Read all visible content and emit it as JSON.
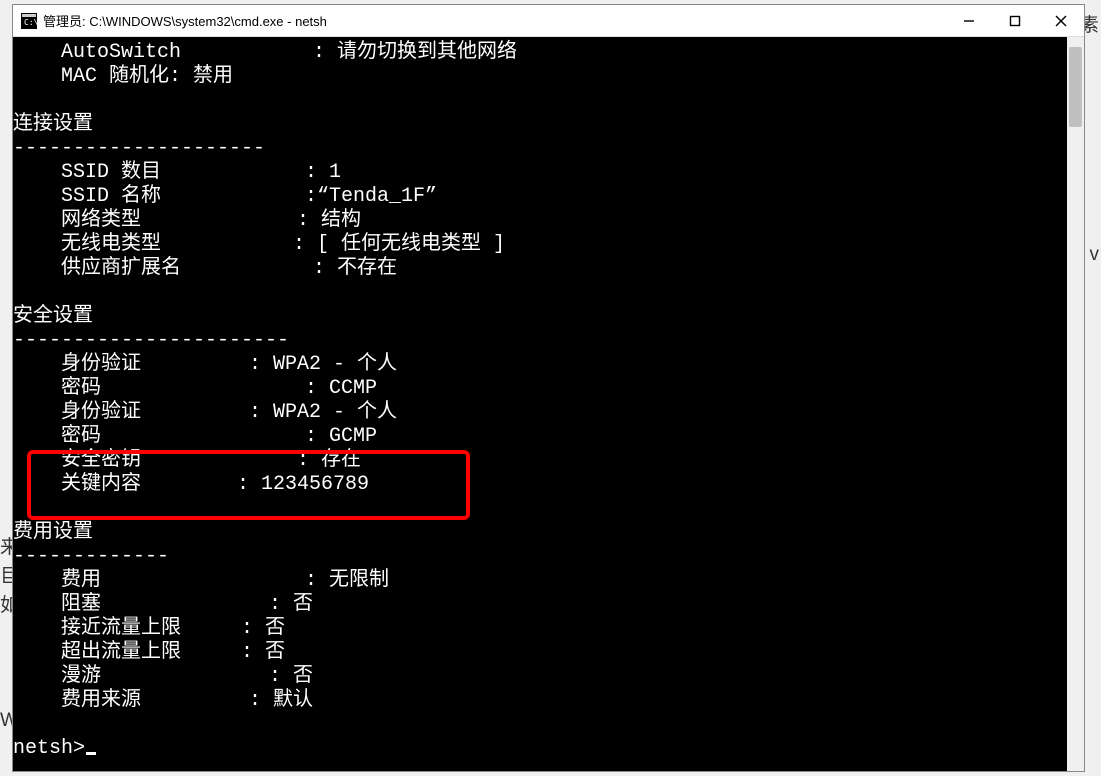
{
  "window": {
    "title": "管理员: C:\\WINDOWS\\system32\\cmd.exe - netsh"
  },
  "outside": {
    "left1": "来",
    "left2": "巨",
    "left3": "如",
    "left4": "W",
    "right1": "素",
    "right2": "v"
  },
  "term": {
    "l01": "    AutoSwitch           : 请勿切换到其他网络",
    "l02": "    MAC 随机化: 禁用",
    "l03": "",
    "l04": "连接设置",
    "l05": "---------------------",
    "l06": "    SSID 数目            : 1",
    "l07": "    SSID 名称            :“Tenda_1F”",
    "l08": "    网络类型             : 结构",
    "l09": "    无线电类型           : [ 任何无线电类型 ]",
    "l10": "    供应商扩展名           : 不存在",
    "l11": "",
    "l12": "安全设置",
    "l13": "-----------------------",
    "l14": "    身份验证         : WPA2 - 个人",
    "l15": "    密码                 : CCMP",
    "l16": "    身份验证         : WPA2 - 个人",
    "l17": "    密码                 : GCMP",
    "l18": "    安全密钥             : 存在",
    "l19": "    关键内容        : 123456789",
    "l20": "",
    "l21": "费用设置",
    "l22": "-------------",
    "l23": "    费用                 : 无限制",
    "l24": "    阻塞              : 否",
    "l25": "    接近流量上限     : 否",
    "l26": "    超出流量上限     : 否",
    "l27": "    漫游              : 否",
    "l28": "    费用来源         : 默认",
    "l29": "",
    "prompt": "netsh>"
  }
}
